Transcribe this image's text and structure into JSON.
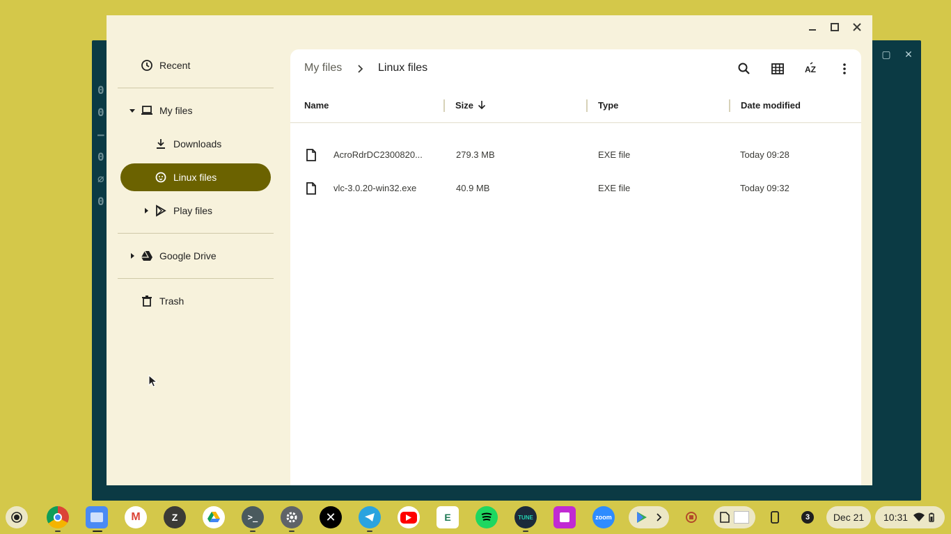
{
  "window": {
    "minimize_icon": "minimize-icon",
    "maximize_icon": "maximize-icon",
    "close_icon": "close-icon"
  },
  "sidebar": {
    "items": [
      {
        "label": "Recent",
        "icon": "clock-icon"
      },
      {
        "label": "My files",
        "icon": "laptop-icon"
      },
      {
        "label": "Downloads",
        "icon": "download-icon"
      },
      {
        "label": "Linux files",
        "icon": "penguin-icon"
      },
      {
        "label": "Play files",
        "icon": "play-store-icon"
      },
      {
        "label": "Google Drive",
        "icon": "drive-icon"
      },
      {
        "label": "Trash",
        "icon": "trash-icon"
      }
    ]
  },
  "breadcrumb": {
    "root": "My files",
    "current": "Linux files"
  },
  "toolbar": {
    "icons": [
      "search-icon",
      "grid-view-icon",
      "sort-az-icon",
      "more-vert-icon"
    ]
  },
  "table": {
    "columns": [
      "Name",
      "Size",
      "Type",
      "Date modified"
    ],
    "sort": {
      "column": "Size",
      "direction": "descending"
    },
    "rows": [
      {
        "name": "AcroRdrDC2300820...",
        "size": "279.3 MB",
        "type": "EXE file",
        "modified": "Today 09:28"
      },
      {
        "name": "vlc-3.0.20-win32.exe",
        "size": "40.9 MB",
        "type": "EXE file",
        "modified": "Today 09:32"
      }
    ]
  },
  "shelf": {
    "notification_count": "3",
    "date": "Dec 21",
    "time": "10:31"
  },
  "colors": {
    "wallpaper": "#d4c84a",
    "window_bg": "#f7f2dc",
    "accent": "#6b6200",
    "terminal_bg": "#0b3a44"
  }
}
